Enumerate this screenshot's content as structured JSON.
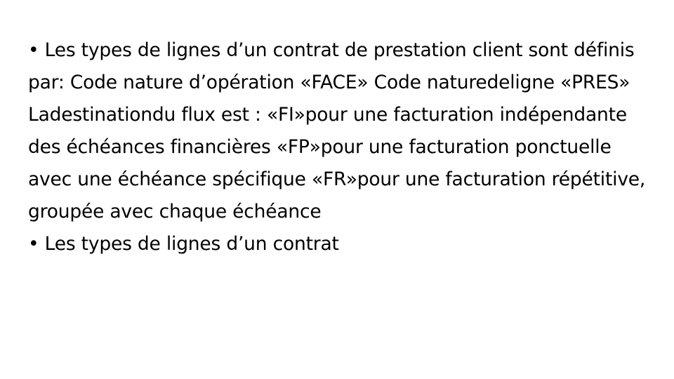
{
  "slide": {
    "paragraphs": [
      "• Les types de lignes d’un contrat de prestation client sont définis par:  Code nature d’opération «FACE»  Code naturedeligne «PRES»  Ladestinationdu flux est :  «FI»pour une facturation indépendante des échéances financières  «FP»pour une facturation ponctuelle avec une échéance spécifique  «FR»pour une facturation répétitive, groupée avec chaque échéance",
      "• Les types de lignes d’un contrat"
    ]
  }
}
